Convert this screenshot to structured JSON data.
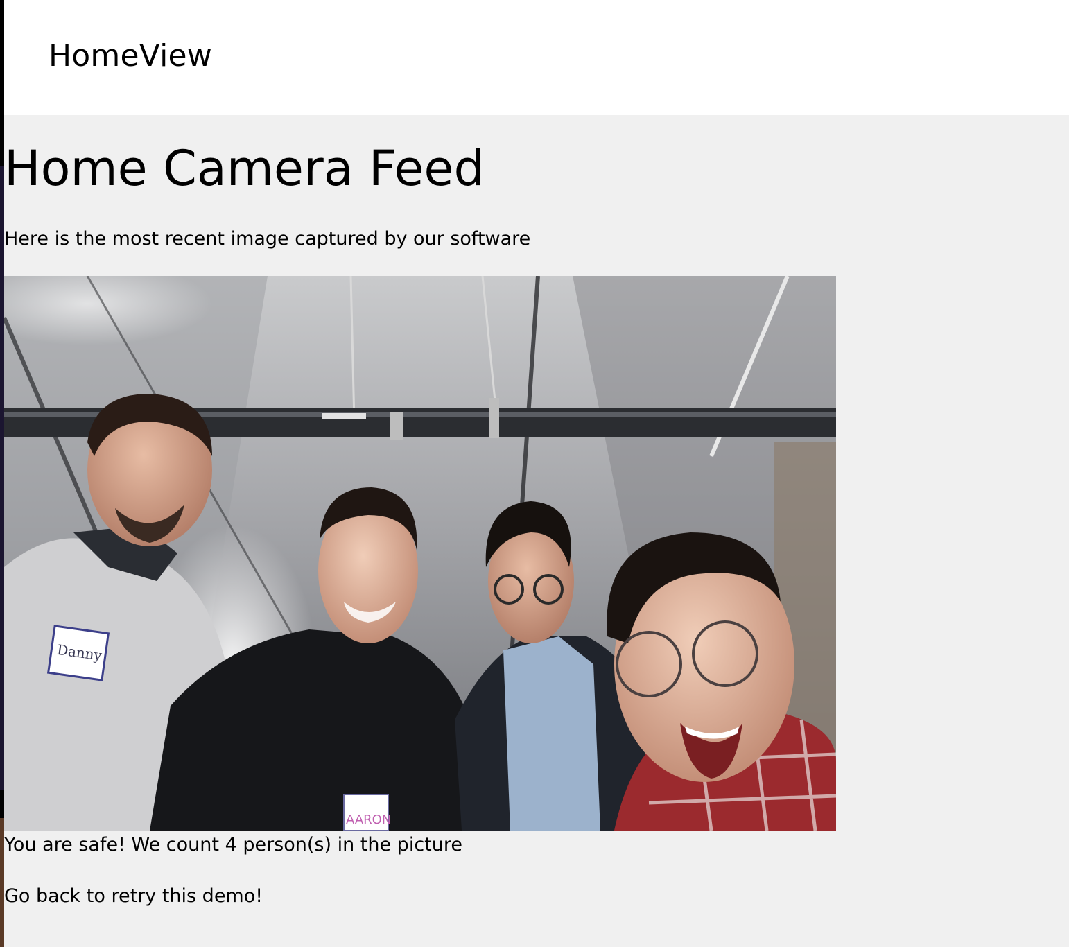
{
  "app": {
    "brand": "HomeView"
  },
  "main": {
    "title": "Home Camera Feed",
    "subtitle": "Here is the most recent image captured by our software",
    "camera_image": {
      "name_tags": [
        "Danny",
        "AARON"
      ]
    },
    "status": "You are safe! We count 4 person(s) in the picture",
    "back_link": "Go back to retry this demo!"
  },
  "colors": {
    "header_bg": "#ffffff",
    "content_bg": "#f0f0f0",
    "text": "#000000"
  }
}
